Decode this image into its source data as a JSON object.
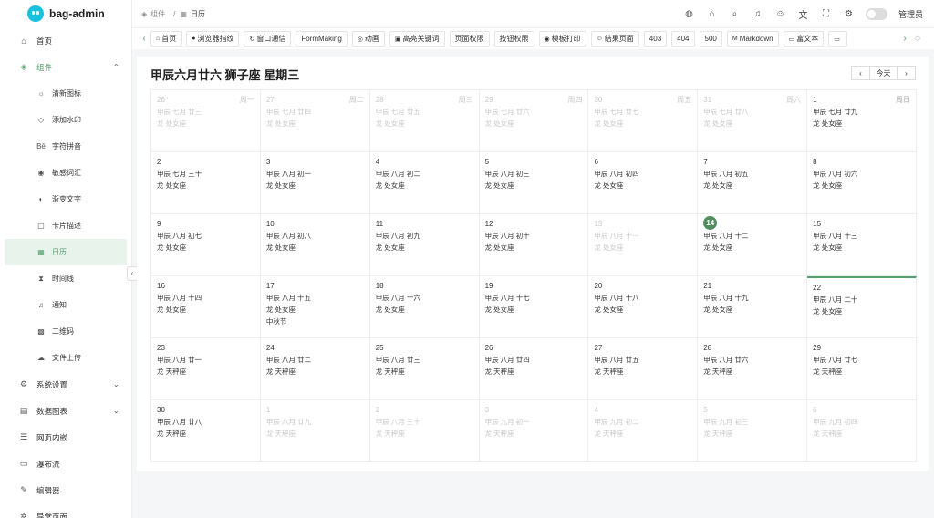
{
  "app": {
    "title": "bag-admin"
  },
  "sidebar": {
    "items": [
      {
        "label": "首页",
        "icon": "home-icon",
        "glyph": "⌂"
      },
      {
        "label": "组件",
        "icon": "cube-icon",
        "glyph": "◈",
        "open": true
      },
      {
        "label": "系统设置",
        "icon": "gear-icon",
        "glyph": "⚙"
      },
      {
        "label": "数据图表",
        "icon": "chart-icon",
        "glyph": "▤"
      },
      {
        "label": "网页内嵌",
        "icon": "layers-icon",
        "glyph": "☰"
      },
      {
        "label": "瀑布流",
        "icon": "monitor-icon",
        "glyph": "▭"
      },
      {
        "label": "编辑器",
        "icon": "edit-icon",
        "glyph": "✎"
      },
      {
        "label": "导常页面",
        "icon": "bug-icon",
        "glyph": "✲"
      }
    ],
    "sub_items": [
      {
        "label": "清新图标",
        "glyph": "☼"
      },
      {
        "label": "添加水印",
        "glyph": "◇"
      },
      {
        "label": "字符拼音",
        "glyph": "Bē"
      },
      {
        "label": "敏感词汇",
        "glyph": "◉"
      },
      {
        "label": "渐变文字",
        "glyph": "◐"
      },
      {
        "label": "卡片描述",
        "glyph": "▢"
      },
      {
        "label": "日历",
        "glyph": "▦",
        "active": true
      },
      {
        "label": "时间线",
        "glyph": "⧗"
      },
      {
        "label": "通知",
        "glyph": "♫"
      },
      {
        "label": "二维码",
        "glyph": "▩"
      },
      {
        "label": "文件上传",
        "glyph": "☁"
      }
    ]
  },
  "breadcrumb": {
    "parent": "组件",
    "sep": "/",
    "current": "日历"
  },
  "header": {
    "user": "管理员",
    "toggle_label": "◐"
  },
  "tabs": [
    {
      "label": "首页",
      "glyph": "⌂"
    },
    {
      "label": "浏览器指纹",
      "glyph": "●"
    },
    {
      "label": "窗口通信",
      "glyph": "↻"
    },
    {
      "label": "FormMaking",
      "glyph": ""
    },
    {
      "label": "动画",
      "glyph": "◎"
    },
    {
      "label": "高亮关键词",
      "glyph": "▣"
    },
    {
      "label": "页面权限",
      "glyph": ""
    },
    {
      "label": "按钮权限",
      "glyph": ""
    },
    {
      "label": "模板打印",
      "glyph": "◉"
    },
    {
      "label": "结果页面",
      "glyph": "☺"
    },
    {
      "label": "403",
      "glyph": ""
    },
    {
      "label": "404",
      "glyph": ""
    },
    {
      "label": "500",
      "glyph": ""
    },
    {
      "label": "Markdown",
      "glyph": "M"
    },
    {
      "label": "富文本",
      "glyph": "▭"
    },
    {
      "label": "",
      "glyph": "▭"
    }
  ],
  "calendar": {
    "title": "甲辰六月廿六 狮子座 星期三",
    "prev_label": "‹",
    "today_label": "今天",
    "next_label": "›",
    "weeks": [
      [
        {
          "d": "26",
          "w": "周一",
          "l": "甲辰 七月 廿三",
          "z": "龙 处女座",
          "o": true
        },
        {
          "d": "27",
          "w": "周二",
          "l": "甲辰 七月 廿四",
          "z": "龙 处女座",
          "o": true
        },
        {
          "d": "28",
          "w": "周三",
          "l": "甲辰 七月 廿五",
          "z": "龙 处女座",
          "o": true
        },
        {
          "d": "29",
          "w": "周四",
          "l": "甲辰 七月 廿六",
          "z": "龙 处女座",
          "o": true
        },
        {
          "d": "30",
          "w": "周五",
          "l": "甲辰 七月 廿七",
          "z": "龙 处女座",
          "o": true
        },
        {
          "d": "31",
          "w": "周六",
          "l": "甲辰 七月 廿八",
          "z": "龙 处女座",
          "o": true
        },
        {
          "d": "1",
          "w": "周日",
          "l": "甲辰 七月 廿九",
          "z": "龙 处女座"
        }
      ],
      [
        {
          "d": "2",
          "l": "甲辰 七月 三十",
          "z": "龙 处女座"
        },
        {
          "d": "3",
          "l": "甲辰 八月 初一",
          "z": "龙 处女座"
        },
        {
          "d": "4",
          "l": "甲辰 八月 初二",
          "z": "龙 处女座"
        },
        {
          "d": "5",
          "l": "甲辰 八月 初三",
          "z": "龙 处女座"
        },
        {
          "d": "6",
          "l": "甲辰 八月 初四",
          "z": "龙 处女座"
        },
        {
          "d": "7",
          "l": "甲辰 八月 初五",
          "z": "龙 处女座"
        },
        {
          "d": "8",
          "l": "甲辰 八月 初六",
          "z": "龙 处女座"
        }
      ],
      [
        {
          "d": "9",
          "l": "甲辰 八月 初七",
          "z": "龙 处女座"
        },
        {
          "d": "10",
          "l": "甲辰 八月 初八",
          "z": "龙 处女座"
        },
        {
          "d": "11",
          "l": "甲辰 八月 初九",
          "z": "龙 处女座"
        },
        {
          "d": "12",
          "l": "甲辰 八月 初十",
          "z": "龙 处女座"
        },
        {
          "d": "13",
          "l": "甲辰 八月 十一",
          "z": "龙 处女座",
          "o": true
        },
        {
          "d": "14",
          "l": "甲辰 八月 十二",
          "z": "龙 处女座",
          "t": true
        },
        {
          "d": "15",
          "l": "甲辰 八月 十三",
          "z": "龙 处女座"
        }
      ],
      [
        {
          "d": "16",
          "l": "甲辰 八月 十四",
          "z": "龙 处女座"
        },
        {
          "d": "17",
          "l": "甲辰 八月 十五",
          "z": "龙 处女座",
          "f": "中秋节"
        },
        {
          "d": "18",
          "l": "甲辰 八月 十六",
          "z": "龙 处女座"
        },
        {
          "d": "19",
          "l": "甲辰 八月 十七",
          "z": "龙 处女座"
        },
        {
          "d": "20",
          "l": "甲辰 八月 十八",
          "z": "龙 处女座"
        },
        {
          "d": "21",
          "l": "甲辰 八月 十九",
          "z": "龙 处女座"
        },
        {
          "d": "22",
          "l": "甲辰 八月 二十",
          "z": "龙 处女座",
          "s": true
        }
      ],
      [
        {
          "d": "23",
          "l": "甲辰 八月 廿一",
          "z": "龙 天秤座"
        },
        {
          "d": "24",
          "l": "甲辰 八月 廿二",
          "z": "龙 天秤座"
        },
        {
          "d": "25",
          "l": "甲辰 八月 廿三",
          "z": "龙 天秤座"
        },
        {
          "d": "26",
          "l": "甲辰 八月 廿四",
          "z": "龙 天秤座"
        },
        {
          "d": "27",
          "l": "甲辰 八月 廿五",
          "z": "龙 天秤座"
        },
        {
          "d": "28",
          "l": "甲辰 八月 廿六",
          "z": "龙 天秤座"
        },
        {
          "d": "29",
          "l": "甲辰 八月 廿七",
          "z": "龙 天秤座"
        }
      ],
      [
        {
          "d": "30",
          "l": "甲辰 八月 廿八",
          "z": "龙 天秤座"
        },
        {
          "d": "1",
          "l": "甲辰 八月 廿九",
          "z": "龙 天秤座",
          "o": true
        },
        {
          "d": "2",
          "l": "甲辰 八月 三十",
          "z": "龙 天秤座",
          "o": true
        },
        {
          "d": "3",
          "l": "甲辰 九月 初一",
          "z": "龙 天秤座",
          "o": true
        },
        {
          "d": "4",
          "l": "甲辰 九月 初二",
          "z": "龙 天秤座",
          "o": true
        },
        {
          "d": "5",
          "l": "甲辰 九月 初三",
          "z": "龙 天秤座",
          "o": true
        },
        {
          "d": "6",
          "l": "甲辰 九月 初四",
          "z": "龙 天秤座",
          "o": true
        }
      ]
    ]
  },
  "colors": {
    "accent": "#52a06a",
    "today": "#4f8e5e",
    "logo": "#1ac0e0"
  }
}
